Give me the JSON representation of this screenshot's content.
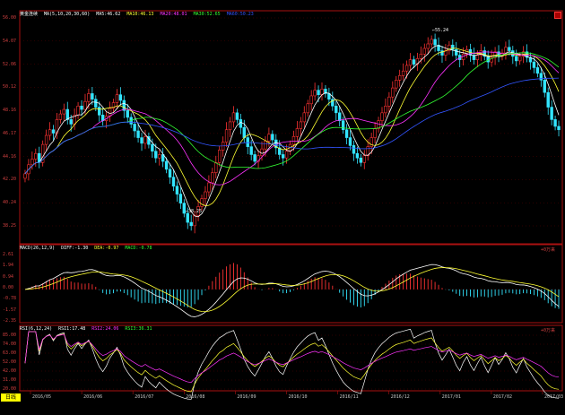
{
  "colors": {
    "up": "#ff3333",
    "down": "#33e5ff",
    "ma5": "#ffffff",
    "ma10": "#ffff33",
    "ma20": "#ff33ff",
    "ma30": "#33ff33",
    "ma60": "#3355ff",
    "dif": "#ffffff",
    "dea": "#ffff33",
    "macd_pos": "#ff3333",
    "macd_neg": "#33e5ff",
    "rsi1": "#ffffff",
    "rsi2": "#ffff33",
    "rsi3": "#ff33ff",
    "frame": "#aa1111",
    "grid": "#5a0000"
  },
  "main": {
    "title": "黄金连续",
    "ma_label": "MA(5,10,20,30,60)",
    "ma5": "MA5:46.62",
    "ma10": "MA10:46.13",
    "ma20": "MA20:48.01",
    "ma30": "MA30:52.65",
    "ma60": "MA60:50.23",
    "y_ticks": [
      "56.00",
      "54.07",
      "52.06",
      "50.12",
      "48.16",
      "46.17",
      "44.16",
      "42.20",
      "40.24",
      "38.25"
    ],
    "low_label": "←38.25",
    "high_label": "←55.24",
    "close_icon": "close-icon"
  },
  "macd": {
    "label": "MACD(26,12,9)",
    "diff": "DIFF:-1.30",
    "dea": "DEA:-0.97",
    "macd": "MACD:-0.78",
    "y_ticks": [
      "2.61",
      "1.94",
      "0.94",
      "0.00",
      "-0.78",
      "-1.57",
      "-2.35"
    ],
    "axis_label": "+0万来",
    "close_icon": "close-icon"
  },
  "rsi": {
    "label": "RSI(6,12,24)",
    "rsi1": "RSI1:17.48",
    "rsi2": "RSI2:24.06",
    "rsi3": "RSI3:36.31",
    "y_ticks": [
      "85.00",
      "74.00",
      "63.00",
      "52.00",
      "42.00",
      "31.00",
      "20.00"
    ],
    "axis_label": "+0万来",
    "close_icon": "close-icon"
  },
  "x_axis": {
    "period_tab": "日线",
    "ticks": [
      "2016/05",
      "2016/06",
      "2016/07",
      "2016/08",
      "2016/09",
      "2016/10",
      "2016/11",
      "2016/12",
      "2017/01",
      "2017/02",
      "2017/03"
    ]
  },
  "chart_data": {
    "type": "candlestick",
    "title": "黄金连续",
    "ylim": [
      37,
      57
    ],
    "series_note_close": [
      43.2,
      44.0,
      44.5,
      45.0,
      44.2,
      45.8,
      46.6,
      47.1,
      46.8,
      48.0,
      48.5,
      48.9,
      48.0,
      47.6,
      48.4,
      49.2,
      48.9,
      49.6,
      50.3,
      49.8,
      49.1,
      48.4,
      47.9,
      48.3,
      49.0,
      49.5,
      50.2,
      49.7,
      48.8,
      48.2,
      47.6,
      47.0,
      46.4,
      45.9,
      46.5,
      45.8,
      45.2,
      44.6,
      44.9,
      44.3,
      43.6,
      42.9,
      42.1,
      41.4,
      40.6,
      39.7,
      38.9,
      38.6,
      39.5,
      40.3,
      41.0,
      41.6,
      42.4,
      43.3,
      44.2,
      45.3,
      46.0,
      47.1,
      47.8,
      48.6,
      48.0,
      47.3,
      46.4,
      45.6,
      44.9,
      44.3,
      44.8,
      45.4,
      46.1,
      46.7,
      46.2,
      45.5,
      44.9,
      44.6,
      45.2,
      45.8,
      46.5,
      47.2,
      47.8,
      48.6,
      49.4,
      50.1,
      50.6,
      50.2,
      50.7,
      50.3,
      49.8,
      49.2,
      48.6,
      47.9,
      47.1,
      46.4,
      45.7,
      45.0,
      44.6,
      44.2,
      44.8,
      45.6,
      46.4,
      47.2,
      47.9,
      48.6,
      49.2,
      50.0,
      50.8,
      51.5,
      51.9,
      52.3,
      52.8,
      53.3,
      52.9,
      53.4,
      53.8,
      54.3,
      54.7,
      55.1,
      54.6,
      54.1,
      53.7,
      54.1,
      54.6,
      54.2,
      53.7,
      53.3,
      53.8,
      54.2,
      53.7,
      53.3,
      53.7,
      54.1,
      53.6,
      53.1,
      53.5,
      54.0,
      53.6,
      53.9,
      54.4,
      54.1,
      53.6,
      53.2,
      53.6,
      54.0,
      53.5,
      53.1,
      52.6,
      52.1,
      51.5,
      50.4,
      49.1,
      48.0,
      47.4,
      47.1
    ]
  }
}
